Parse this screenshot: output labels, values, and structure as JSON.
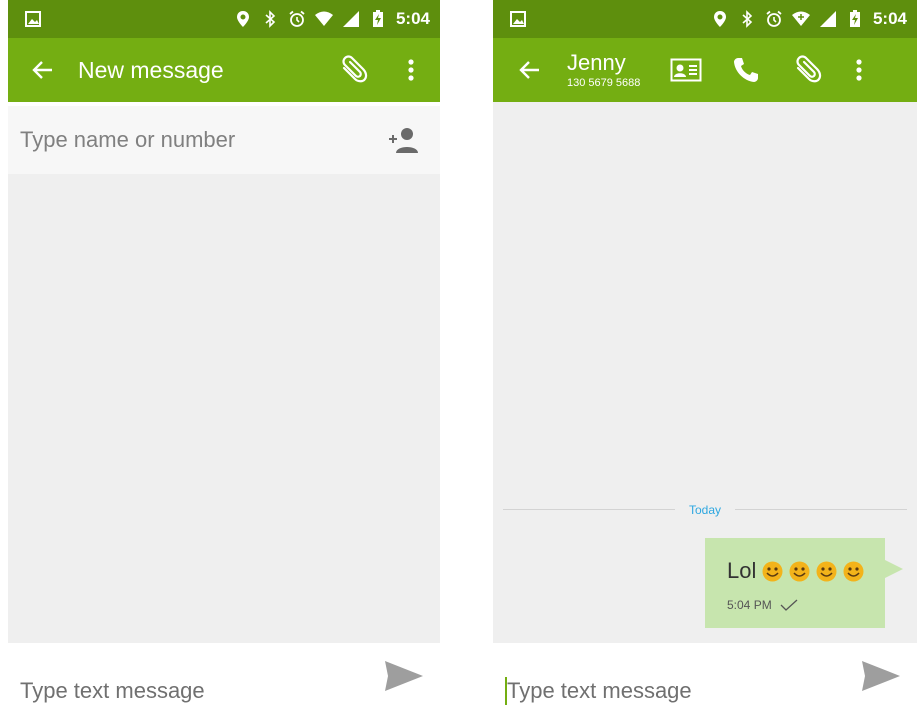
{
  "status_bar": {
    "time": "5:04"
  },
  "left_screen": {
    "app_bar": {
      "title": "New message"
    },
    "recipient": {
      "placeholder": "Type name or number"
    },
    "compose": {
      "placeholder": "Type text message"
    }
  },
  "right_screen": {
    "app_bar": {
      "contact_name": "Jenny",
      "contact_number": "130 5679 5688"
    },
    "conversation": {
      "date_divider": "Today",
      "messages": [
        {
          "text": "Lol",
          "emoji_count": 4,
          "time": "5:04 PM",
          "status": "sent"
        }
      ]
    },
    "compose": {
      "placeholder": "Type text message"
    }
  },
  "colors": {
    "status_bar": "#5e8f0d",
    "app_bar": "#74ae12",
    "bubble": "#c7e5ae",
    "date_label": "#2ea7e0",
    "background": "#efefef"
  },
  "icons": [
    "image-icon",
    "location-icon",
    "bluetooth-icon",
    "alarm-icon",
    "wifi-icon",
    "signal-icon",
    "battery-icon",
    "back-arrow-icon",
    "attach-icon",
    "more-icon",
    "add-contact-icon",
    "send-icon",
    "contact-card-icon",
    "phone-icon",
    "check-icon",
    "smile-emoji-icon"
  ]
}
